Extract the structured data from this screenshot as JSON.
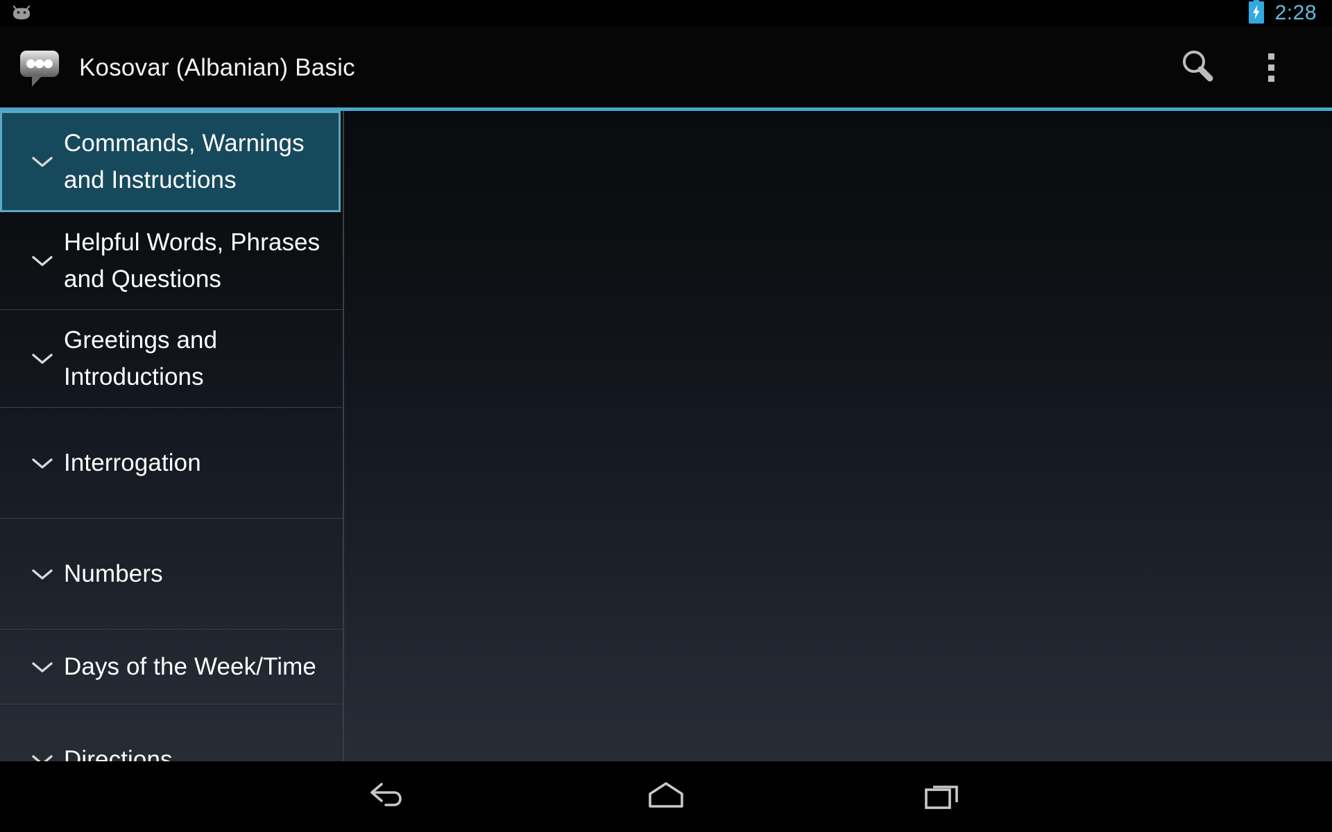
{
  "status_bar": {
    "notification_icon": "android-bugdroid-icon",
    "battery_icon": "battery-charging-icon",
    "time": "2:28",
    "time_color": "#60bcdd"
  },
  "action_bar": {
    "app_icon": "speech-bubble-icon",
    "title": "Kosovar (Albanian) Basic",
    "search_icon": "search-icon",
    "overflow_icon": "overflow-menu-icon",
    "accent_color": "#4aa7cc"
  },
  "list": {
    "selected_index": 0,
    "selected_bg": "#17495c",
    "selected_border": "#5ba8c4",
    "items": [
      {
        "label": "Commands, Warnings and Instructions",
        "expander_icon": "chevron-down-icon",
        "selected": true
      },
      {
        "label": "Helpful Words, Phrases and Questions",
        "expander_icon": "chevron-down-icon",
        "selected": false
      },
      {
        "label": "Greetings and Introductions",
        "expander_icon": "chevron-down-icon",
        "selected": false
      },
      {
        "label": "Interrogation",
        "expander_icon": "chevron-down-icon",
        "selected": false
      },
      {
        "label": "Numbers",
        "expander_icon": "chevron-down-icon",
        "selected": false
      },
      {
        "label": "Days of the Week/Time",
        "expander_icon": "chevron-down-icon",
        "selected": false
      },
      {
        "label": "Directions",
        "expander_icon": "chevron-down-icon",
        "selected": false
      }
    ]
  },
  "nav_bar": {
    "back_icon": "back-arrow-icon",
    "home_icon": "home-icon",
    "recents_icon": "recent-apps-icon"
  }
}
